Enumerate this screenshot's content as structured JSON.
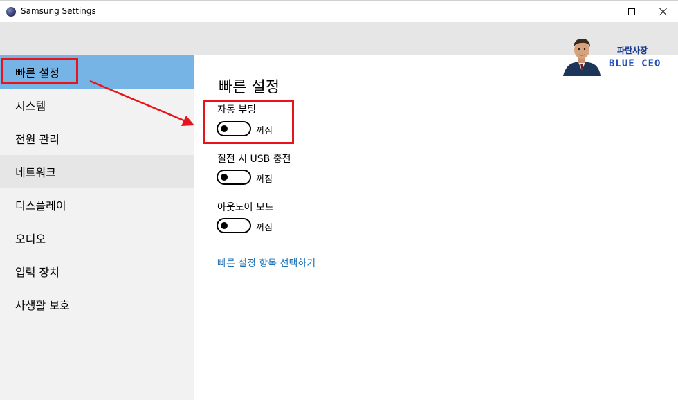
{
  "window": {
    "title": "Samsung Settings",
    "icon": "samsung-settings-icon"
  },
  "sidebar": {
    "items": [
      {
        "label": "빠른 설정",
        "state": "selected"
      },
      {
        "label": "시스템"
      },
      {
        "label": "전원 관리"
      },
      {
        "label": "네트워크",
        "state": "hover"
      },
      {
        "label": "디스플레이"
      },
      {
        "label": "오디오"
      },
      {
        "label": "입력 장치"
      },
      {
        "label": "사생활 보호"
      }
    ]
  },
  "main": {
    "title": "빠른 설정",
    "settings": [
      {
        "label": "자동 부팅",
        "state": "꺼짐",
        "on": false
      },
      {
        "label": "절전 시 USB 충전",
        "state": "꺼짐",
        "on": false
      },
      {
        "label": "아웃도어 모드",
        "state": "꺼짐",
        "on": false
      }
    ],
    "link": "빠른 설정 항목 선택하기"
  },
  "watermark": {
    "korean": "파란사장",
    "english": "BLUE CEO"
  },
  "colors": {
    "selected": "#77b4e6",
    "hover": "#e6e6e6",
    "sidebar_bg": "#f2f2f2",
    "link": "#1e72b8",
    "annotation": "#e8141c",
    "brand": "#1f4fb8"
  }
}
